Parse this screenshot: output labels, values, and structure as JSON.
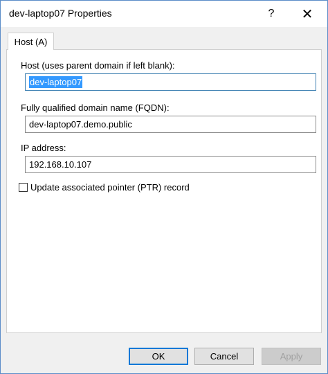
{
  "window": {
    "title": "dev-laptop07 Properties",
    "help_glyph": "?",
    "close_glyph": "✕"
  },
  "tabs": [
    {
      "label": "Host (A)",
      "active": true
    }
  ],
  "form": {
    "host_label": "Host (uses parent domain if left blank):",
    "host_value": "dev-laptop07",
    "fqdn_label": "Fully qualified domain name (FQDN):",
    "fqdn_value": "dev-laptop07.demo.public",
    "ip_label": "IP address:",
    "ip_value": "192.168.10.107",
    "ptr_label": "Update associated pointer (PTR) record",
    "ptr_checked": false
  },
  "buttons": {
    "ok": "OK",
    "cancel": "Cancel",
    "apply": "Apply"
  },
  "colors": {
    "window_border": "#5a8cc8",
    "selection": "#3399ff",
    "default_button_border": "#0078d7"
  },
  "icons": {
    "help": "help-icon",
    "close": "close-icon"
  }
}
